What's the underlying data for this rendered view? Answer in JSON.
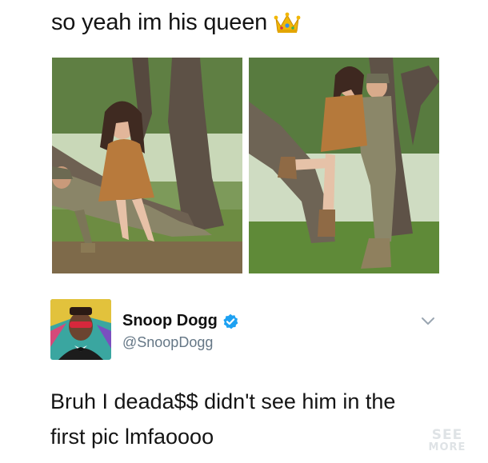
{
  "caption": {
    "text": "so yeah im his queen",
    "emoji": "crown-icon"
  },
  "photos": [
    {
      "name": "photo-left",
      "description_icon": "photo"
    },
    {
      "name": "photo-right",
      "description_icon": "photo"
    }
  ],
  "tweet": {
    "display_name": "Snoop Dogg",
    "handle": "@SnoopDogg",
    "verified": true,
    "text_line1": "Bruh I deada$$ didn't see him in the",
    "text_line2": "first pic lmfaoooo"
  },
  "watermark": {
    "line1": "SEE",
    "line2": "MORE"
  },
  "colors": {
    "text": "#141414",
    "handle": "#657786",
    "verified": "#1da1f2",
    "chevron": "#9aa6b1"
  }
}
